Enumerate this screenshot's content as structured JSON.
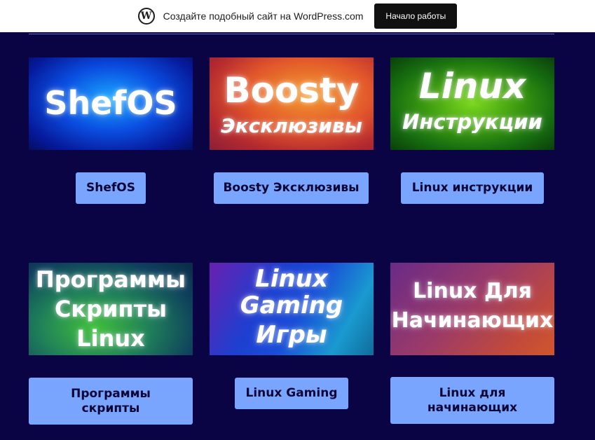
{
  "wp_banner": {
    "text": "Создайте подобный сайт на WordPress.com",
    "button": "Начало работы",
    "logo_glyph": "W"
  },
  "cards": [
    {
      "lines": [
        "ShefOS"
      ],
      "button": "ShefOS"
    },
    {
      "lines": [
        "Boosty",
        "Эксклюзивы"
      ],
      "button": "Boosty Эксклюзивы"
    },
    {
      "lines": [
        "Linux",
        "Инструкции"
      ],
      "button": "Linux инструкции"
    },
    {
      "lines": [
        "Программы",
        "Скрипты",
        "Linux"
      ],
      "button": "Программы скрипты"
    },
    {
      "lines": [
        "Linux",
        "Gaming",
        "Игры"
      ],
      "button": "Linux Gaming"
    },
    {
      "lines": [
        "Linux Для",
        "Начинающих"
      ],
      "button": "Linux для начинающих"
    }
  ],
  "colors": {
    "background": "#0a0344",
    "button": "#7aa5ff",
    "button_text": "#0b0635"
  }
}
